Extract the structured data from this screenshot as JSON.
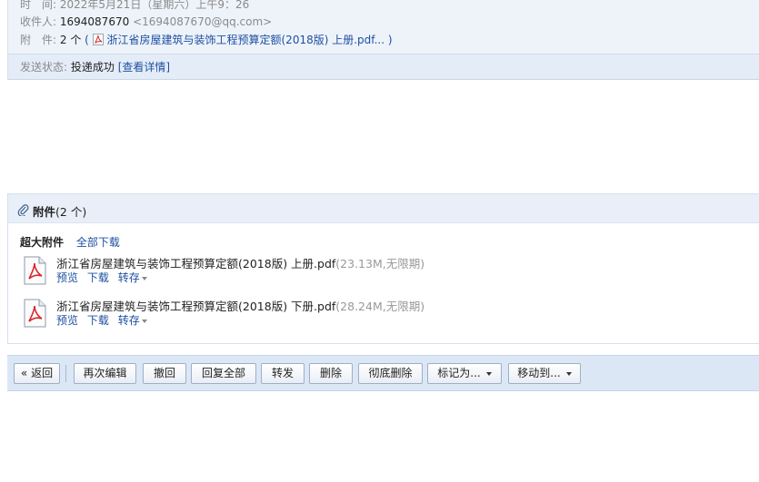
{
  "header": {
    "time_label": "时　间:",
    "time_value": "2022年5月21日（星期六）上午9：26",
    "recipient_label": "收件人:",
    "recipient_name": "1694087670",
    "recipient_email": "<1694087670@qq.com>",
    "attach_label": "附　件:",
    "attach_count": "2 个",
    "attach_open": "(",
    "attach_file_link": "浙江省房屋建筑与装饰工程预算定额(2018版) 上册.pdf...",
    "attach_close": ")",
    "status_label": "发送状态:",
    "status_value": "投递成功",
    "status_detail_link": "[查看详情]"
  },
  "attachments": {
    "title_bold": "附件",
    "title_count": "(2 个)",
    "big_label": "超大附件",
    "download_all": "全部下载",
    "files": [
      {
        "name": "浙江省房屋建筑与装饰工程预算定额(2018版) 上册.pdf",
        "meta": "(23.13M,无限期)",
        "preview": "预览",
        "download": "下载",
        "save": "转存"
      },
      {
        "name": "浙江省房屋建筑与装饰工程预算定额(2018版) 下册.pdf",
        "meta": "(28.24M,无限期)",
        "preview": "预览",
        "download": "下载",
        "save": "转存"
      }
    ]
  },
  "toolbar": {
    "back": "« 返回",
    "reedit": "再次编辑",
    "recall": "撤回",
    "reply_all": "回复全部",
    "forward": "转发",
    "delete": "删除",
    "delete_forever": "彻底删除",
    "mark_as": "标记为...",
    "move_to": "移动到..."
  },
  "colors": {
    "link": "#1e50a2",
    "header_bg": "#eef3fa",
    "toolbar_bg": "#dce7f6",
    "pdf_red": "#d8262e"
  }
}
